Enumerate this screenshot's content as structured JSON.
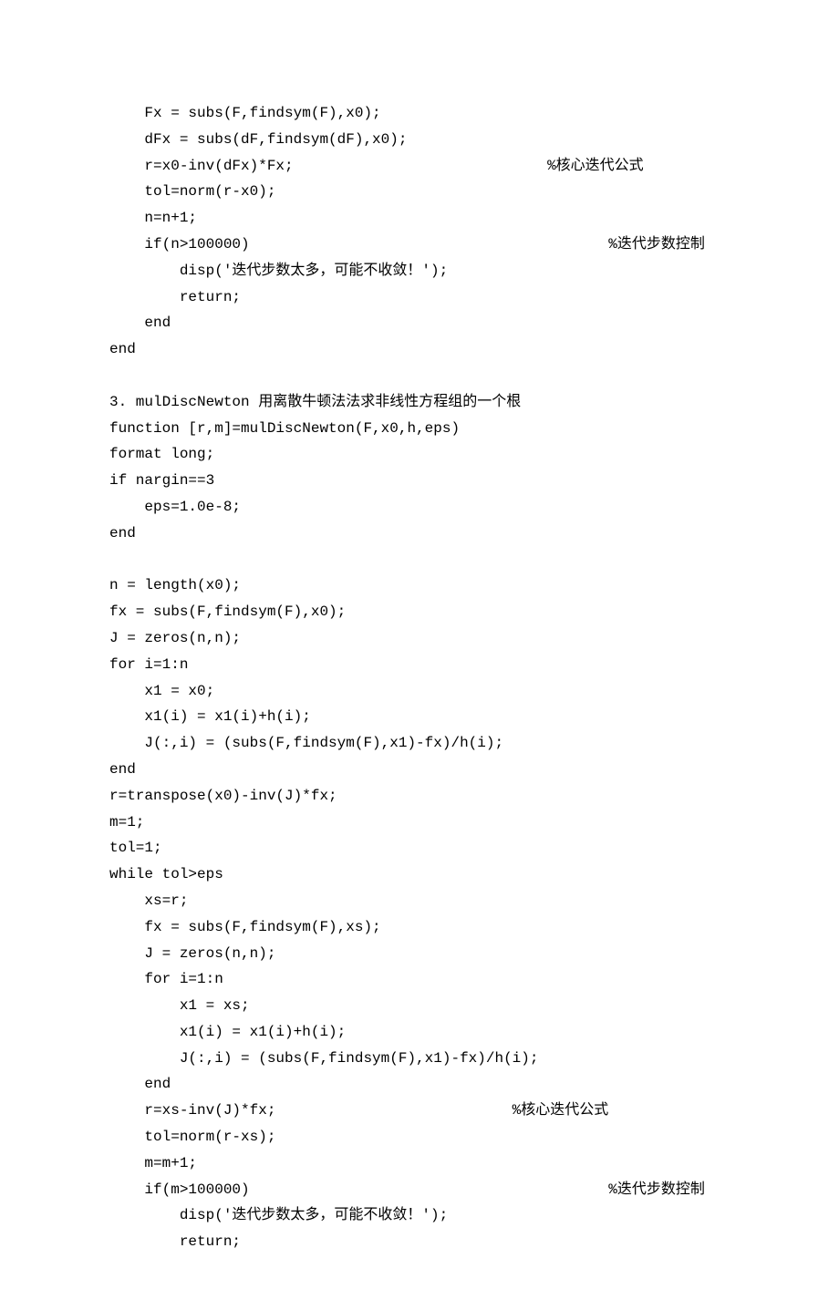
{
  "lines": [
    {
      "cls": "indent1",
      "text": "Fx = subs(F,findsym(F),x0);"
    },
    {
      "cls": "indent1",
      "text": "dFx = subs(dF,findsym(dF),x0);"
    },
    {
      "cls": "indent1",
      "text": "r=x0-inv(dFx)*Fx;                             %核心迭代公式"
    },
    {
      "cls": "indent1",
      "text": "tol=norm(r-x0);"
    },
    {
      "cls": "indent1",
      "text": "n=n+1;"
    },
    {
      "cls": "indent1",
      "text": "if(n>100000)                                         %迭代步数控制"
    },
    {
      "cls": "indent2",
      "text": "disp('迭代步数太多，可能不收敛！');"
    },
    {
      "cls": "indent2",
      "text": "return;"
    },
    {
      "cls": "indent1",
      "text": "end"
    },
    {
      "cls": "",
      "text": "end"
    },
    {
      "cls": "",
      "text": ""
    },
    {
      "cls": "",
      "text": "3. mulDiscNewton 用离散牛顿法法求非线性方程组的一个根"
    },
    {
      "cls": "",
      "text": "function [r,m]=mulDiscNewton(F,x0,h,eps)"
    },
    {
      "cls": "",
      "text": "format long;"
    },
    {
      "cls": "",
      "text": "if nargin==3"
    },
    {
      "cls": "indent1",
      "text": "eps=1.0e-8;"
    },
    {
      "cls": "",
      "text": "end"
    },
    {
      "cls": "",
      "text": ""
    },
    {
      "cls": "",
      "text": "n = length(x0);"
    },
    {
      "cls": "",
      "text": "fx = subs(F,findsym(F),x0);"
    },
    {
      "cls": "",
      "text": "J = zeros(n,n);"
    },
    {
      "cls": "",
      "text": "for i=1:n"
    },
    {
      "cls": "indent1",
      "text": "x1 = x0;"
    },
    {
      "cls": "indent1",
      "text": "x1(i) = x1(i)+h(i);"
    },
    {
      "cls": "indent1",
      "text": "J(:,i) = (subs(F,findsym(F),x1)-fx)/h(i);"
    },
    {
      "cls": "",
      "text": "end"
    },
    {
      "cls": "",
      "text": "r=transpose(x0)-inv(J)*fx;"
    },
    {
      "cls": "",
      "text": "m=1;"
    },
    {
      "cls": "",
      "text": "tol=1;"
    },
    {
      "cls": "",
      "text": "while tol>eps"
    },
    {
      "cls": "indent1",
      "text": "xs=r;"
    },
    {
      "cls": "indent1",
      "text": "fx = subs(F,findsym(F),xs);"
    },
    {
      "cls": "indent1",
      "text": "J = zeros(n,n);"
    },
    {
      "cls": "indent1",
      "text": "for i=1:n"
    },
    {
      "cls": "indent2",
      "text": "x1 = xs;"
    },
    {
      "cls": "indent2",
      "text": "x1(i) = x1(i)+h(i);"
    },
    {
      "cls": "indent2",
      "text": "J(:,i) = (subs(F,findsym(F),x1)-fx)/h(i);"
    },
    {
      "cls": "indent1",
      "text": "end"
    },
    {
      "cls": "indent1",
      "text": "r=xs-inv(J)*fx;                           %核心迭代公式"
    },
    {
      "cls": "indent1",
      "text": "tol=norm(r-xs);"
    },
    {
      "cls": "indent1",
      "text": "m=m+1;"
    },
    {
      "cls": "indent1",
      "text": "if(m>100000)                                         %迭代步数控制"
    },
    {
      "cls": "indent2",
      "text": "disp('迭代步数太多，可能不收敛！');"
    },
    {
      "cls": "indent2",
      "text": "return;"
    }
  ]
}
